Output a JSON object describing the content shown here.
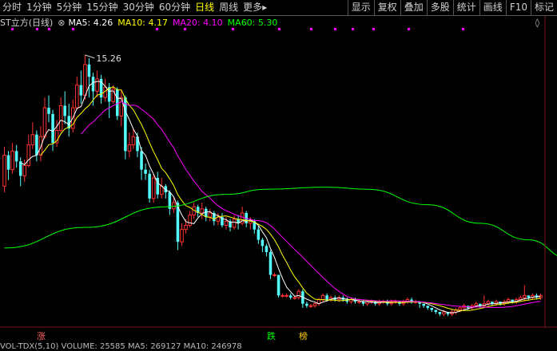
{
  "toolbar": {
    "periods": [
      "分时",
      "1分钟",
      "5分钟",
      "15分钟",
      "30分钟",
      "60分钟",
      "日线",
      "周线",
      "更多"
    ],
    "active": "日线",
    "more_arrow": "▸",
    "buttons": [
      "显示",
      "复权",
      "叠加",
      "多股",
      "统计",
      "画线",
      "F10",
      "标记"
    ],
    "expand_icon": "◊"
  },
  "ma_legend": {
    "title": "ST立方(日线)",
    "settings_icon": "⊗",
    "items": [
      {
        "label": "MA5: 4.26",
        "color": "#ffffff"
      },
      {
        "label": "MA10: 4.17",
        "color": "#ffff00"
      },
      {
        "label": "MA20: 4.10",
        "color": "#ff00ff"
      },
      {
        "label": "MA60: 5.30",
        "color": "#00ff00"
      }
    ]
  },
  "annotations": {
    "high": "15.26",
    "marker_zhang": "涨",
    "marker_die": "跌",
    "marker_bang": "榜"
  },
  "volume_line": "VOL-TDX(5,10) VOLUME: 25585 MA5: 269127 MA10: 246978",
  "chart_data": {
    "type": "candlestick",
    "ylim": [
      2.3,
      16.3
    ],
    "colors": {
      "up": "#ff3232",
      "down": "#54ffff",
      "ma5": "#ffffff",
      "ma10": "#ffff00",
      "ma20": "#ff00ff",
      "ma60": "#00ff00"
    },
    "candles": [
      [
        8.9,
        10.4,
        8.6,
        10.8
      ],
      [
        10.4,
        9.7,
        9.2,
        10.6
      ],
      [
        9.7,
        10.6,
        9.5,
        11.0
      ],
      [
        10.6,
        10.1,
        9.8,
        10.9
      ],
      [
        10.1,
        9.4,
        8.9,
        10.3
      ],
      [
        9.4,
        9.9,
        9.1,
        10.2
      ],
      [
        9.9,
        10.9,
        9.8,
        11.4
      ],
      [
        10.9,
        11.4,
        10.7,
        12.0
      ],
      [
        11.4,
        10.4,
        10.1,
        11.6
      ],
      [
        10.4,
        11.3,
        10.1,
        11.8
      ],
      [
        11.3,
        12.7,
        11.2,
        13.2
      ],
      [
        12.7,
        12.4,
        12.0,
        13.3
      ],
      [
        12.4,
        11.0,
        10.6,
        12.6
      ],
      [
        11.0,
        11.6,
        10.8,
        12.1
      ],
      [
        11.6,
        12.8,
        11.5,
        13.2
      ],
      [
        12.8,
        12.3,
        11.9,
        13.5
      ],
      [
        12.3,
        11.7,
        11.3,
        12.9
      ],
      [
        11.7,
        12.7,
        11.5,
        13.1
      ],
      [
        12.7,
        13.8,
        12.6,
        14.2
      ],
      [
        13.8,
        13.3,
        12.9,
        14.5
      ],
      [
        13.3,
        14.8,
        13.1,
        15.26
      ],
      [
        14.8,
        14.2,
        13.2,
        15.1
      ],
      [
        14.2,
        13.5,
        12.8,
        14.4
      ],
      [
        13.5,
        14.1,
        13.2,
        14.5
      ],
      [
        14.1,
        13.2,
        12.9,
        14.3
      ],
      [
        13.2,
        13.7,
        13.0,
        14.1
      ],
      [
        13.7,
        13.0,
        12.2,
        13.9
      ],
      [
        13.0,
        13.6,
        12.9,
        13.8
      ],
      [
        13.6,
        12.3,
        12.1,
        13.7
      ],
      [
        12.3,
        13.2,
        11.8,
        13.6
      ],
      [
        13.2,
        10.6,
        10.2,
        13.3
      ],
      [
        10.6,
        10.9,
        10.3,
        11.5
      ],
      [
        10.9,
        11.3,
        10.7,
        11.7
      ],
      [
        11.3,
        10.6,
        10.3,
        11.5
      ],
      [
        10.6,
        9.7,
        9.2,
        10.8
      ],
      [
        9.7,
        9.5,
        9.2,
        10.0
      ],
      [
        9.5,
        8.3,
        8.1,
        9.7
      ],
      [
        8.3,
        9.3,
        8.1,
        9.5
      ],
      [
        9.3,
        8.5,
        8.3,
        9.6
      ],
      [
        8.5,
        8.9,
        8.3,
        9.3
      ],
      [
        8.9,
        8.6,
        8.3,
        9.0
      ],
      [
        8.6,
        7.8,
        7.5,
        8.7
      ],
      [
        7.8,
        8.1,
        7.6,
        8.4
      ],
      [
        8.1,
        6.2,
        5.8,
        8.2
      ],
      [
        6.2,
        6.8,
        6.0,
        7.1
      ],
      [
        6.8,
        7.0,
        6.6,
        7.3
      ],
      [
        7.0,
        7.5,
        6.9,
        7.7
      ],
      [
        7.5,
        7.9,
        7.3,
        8.1
      ],
      [
        7.9,
        7.6,
        7.4,
        8.0
      ],
      [
        7.6,
        7.8,
        7.3,
        8.1
      ],
      [
        7.8,
        7.4,
        7.2,
        7.9
      ],
      [
        7.4,
        7.6,
        7.2,
        7.8
      ],
      [
        7.6,
        7.2,
        7.0,
        7.7
      ],
      [
        7.2,
        7.4,
        7.0,
        7.6
      ],
      [
        7.4,
        7.0,
        6.9,
        7.6
      ],
      [
        7.0,
        7.2,
        6.8,
        7.4
      ],
      [
        7.2,
        6.9,
        6.7,
        7.3
      ],
      [
        6.9,
        7.3,
        6.8,
        7.5
      ],
      [
        7.3,
        7.1,
        6.8,
        7.5
      ],
      [
        7.1,
        7.6,
        7.0,
        7.9
      ],
      [
        7.6,
        7.1,
        6.9,
        7.7
      ],
      [
        7.1,
        7.2,
        6.8,
        7.4
      ],
      [
        7.2,
        6.8,
        6.6,
        7.3
      ],
      [
        6.8,
        6.3,
        6.1,
        7.0
      ],
      [
        6.3,
        6.0,
        5.7,
        6.4
      ],
      [
        6.0,
        5.7,
        5.5,
        6.1
      ],
      [
        5.7,
        4.6,
        4.4,
        5.8
      ],
      [
        4.6,
        4.6,
        4.5,
        4.7
      ],
      [
        4.6,
        3.6,
        3.5,
        3.7
      ],
      [
        3.6,
        3.6,
        3.5,
        3.7
      ],
      [
        3.6,
        3.6,
        3.5,
        3.7
      ],
      [
        3.6,
        3.5,
        3.4,
        3.7
      ],
      [
        3.5,
        3.5,
        3.4,
        3.6
      ],
      [
        3.5,
        3.8,
        3.4,
        3.9
      ],
      [
        3.8,
        3.2,
        3.0,
        3.9
      ],
      [
        3.2,
        3.1,
        3.0,
        3.3
      ],
      [
        3.1,
        3.1,
        3.0,
        3.2
      ],
      [
        3.1,
        3.2,
        3.0,
        3.3
      ],
      [
        3.2,
        3.4,
        3.1,
        3.5
      ],
      [
        3.4,
        3.6,
        3.3,
        3.7
      ],
      [
        3.6,
        3.4,
        3.3,
        3.7
      ],
      [
        3.4,
        3.5,
        3.3,
        3.6
      ],
      [
        3.5,
        3.4,
        3.3,
        3.6
      ],
      [
        3.4,
        3.5,
        3.3,
        3.6
      ],
      [
        3.5,
        3.4,
        3.3,
        3.6
      ],
      [
        3.4,
        3.3,
        3.2,
        3.5
      ],
      [
        3.3,
        3.4,
        3.2,
        3.5
      ],
      [
        3.4,
        3.3,
        3.2,
        3.5
      ],
      [
        3.3,
        3.3,
        3.2,
        3.4
      ],
      [
        3.3,
        3.2,
        3.1,
        3.4
      ],
      [
        3.2,
        3.3,
        3.1,
        3.4
      ],
      [
        3.3,
        3.3,
        3.2,
        3.4
      ],
      [
        3.3,
        3.2,
        3.1,
        3.3
      ],
      [
        3.2,
        3.3,
        3.1,
        3.4
      ],
      [
        3.3,
        3.3,
        3.2,
        3.4
      ],
      [
        3.3,
        3.2,
        3.1,
        3.4
      ],
      [
        3.2,
        3.3,
        3.1,
        3.4
      ],
      [
        3.3,
        3.3,
        3.2,
        3.4
      ],
      [
        3.3,
        3.2,
        3.1,
        3.3
      ],
      [
        3.2,
        3.3,
        3.1,
        3.4
      ],
      [
        3.3,
        3.4,
        3.2,
        3.5
      ],
      [
        3.4,
        3.3,
        3.2,
        3.5
      ],
      [
        3.3,
        3.3,
        3.2,
        3.4
      ],
      [
        3.3,
        3.2,
        3.0,
        3.3
      ],
      [
        3.2,
        3.1,
        3.0,
        3.2
      ],
      [
        3.1,
        3.0,
        2.9,
        3.1
      ],
      [
        3.0,
        2.9,
        2.8,
        3.0
      ],
      [
        2.9,
        2.8,
        2.7,
        2.9
      ],
      [
        2.8,
        2.7,
        2.6,
        2.8
      ],
      [
        2.7,
        2.8,
        2.6,
        2.9
      ],
      [
        2.8,
        2.7,
        2.6,
        2.8
      ],
      [
        2.7,
        2.8,
        2.6,
        2.9
      ],
      [
        2.8,
        2.9,
        2.7,
        3.0
      ],
      [
        2.9,
        3.0,
        2.8,
        3.1
      ],
      [
        3.0,
        3.1,
        2.9,
        3.2
      ],
      [
        3.1,
        3.0,
        2.9,
        3.1
      ],
      [
        3.0,
        3.1,
        2.9,
        3.2
      ],
      [
        3.1,
        3.2,
        3.0,
        3.3
      ],
      [
        3.2,
        3.1,
        3.0,
        3.2
      ],
      [
        3.1,
        3.2,
        3.0,
        3.6
      ],
      [
        3.2,
        3.3,
        3.1,
        3.4
      ],
      [
        3.3,
        3.2,
        3.1,
        3.3
      ],
      [
        3.2,
        3.3,
        3.1,
        3.4
      ],
      [
        3.3,
        3.2,
        3.1,
        3.3
      ],
      [
        3.2,
        3.3,
        3.1,
        3.4
      ],
      [
        3.3,
        3.4,
        3.2,
        3.5
      ],
      [
        3.4,
        3.3,
        3.2,
        3.4
      ],
      [
        3.3,
        3.4,
        3.2,
        3.5
      ],
      [
        3.4,
        3.5,
        3.3,
        3.6
      ],
      [
        3.5,
        3.6,
        3.3,
        4.1
      ],
      [
        3.6,
        3.5,
        3.4,
        3.6
      ],
      [
        3.5,
        3.6,
        3.4,
        3.7
      ],
      [
        3.6,
        3.5,
        3.4,
        3.7
      ],
      [
        3.5,
        3.6,
        3.4,
        3.7
      ]
    ],
    "ma60_points": [
      [
        0,
        5.9
      ],
      [
        20,
        6.9
      ],
      [
        40,
        7.9
      ],
      [
        55,
        8.5
      ],
      [
        65,
        8.75
      ],
      [
        80,
        8.85
      ],
      [
        90,
        8.75
      ],
      [
        105,
        8.0
      ],
      [
        118,
        7.1
      ],
      [
        130,
        6.3
      ],
      [
        140,
        5.4
      ]
    ]
  }
}
